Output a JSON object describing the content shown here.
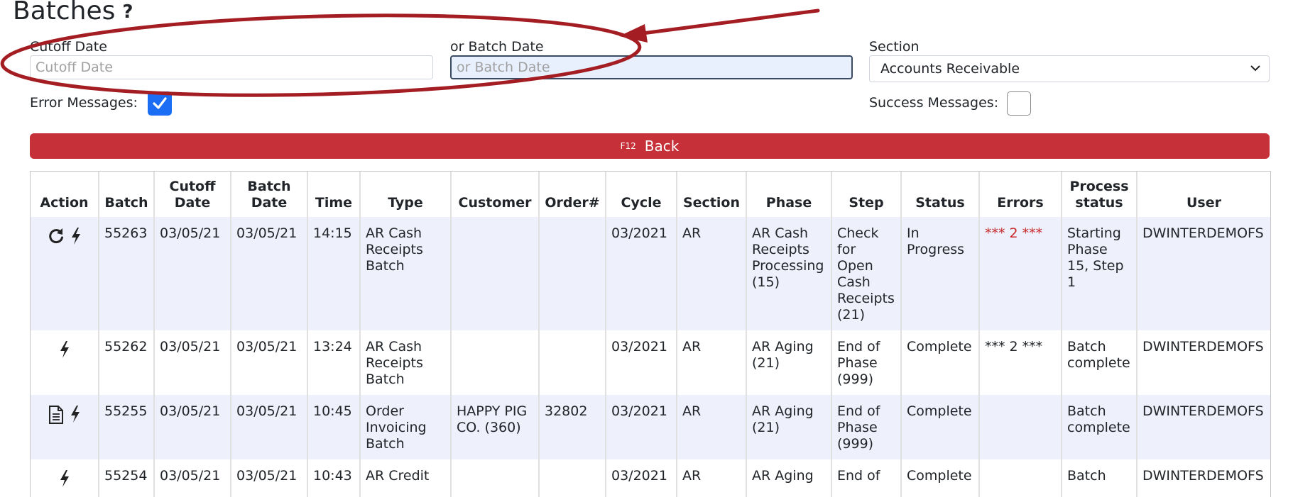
{
  "page": {
    "title": "Batches",
    "help": "?"
  },
  "filters": {
    "cutoff_label": "Cutoff Date",
    "cutoff_placeholder": "Cutoff Date",
    "cutoff_value": "",
    "batch_label": "or Batch Date",
    "batch_placeholder": "or Batch Date",
    "batch_value": "",
    "section_label": "Section",
    "section_value": "Accounts Receivable",
    "error_label": "Error Messages:",
    "error_checked": true,
    "success_label": "Success Messages:",
    "success_checked": false
  },
  "back": {
    "key": "F12",
    "label": "Back"
  },
  "colors": {
    "back_bar": "#c63038",
    "annotation": "#a31d22",
    "checkbox": "#1b6ef3",
    "row_shade": "#eef0fb",
    "error_text": "#c62828"
  },
  "table": {
    "headers": [
      "Action",
      "Batch",
      "Cutoff Date",
      "Batch Date",
      "Time",
      "Type",
      "Customer",
      "Order#",
      "Cycle",
      "Section",
      "Phase",
      "Step",
      "Status",
      "Errors",
      "Process status",
      "User"
    ],
    "rows": [
      {
        "icons": [
          "refresh-icon",
          "bolt-icon"
        ],
        "batch": "55263",
        "cutoff": "03/05/21",
        "batchdate": "03/05/21",
        "time": "14:15",
        "type": "AR Cash Receipts Batch",
        "customer": "",
        "order": "",
        "cycle": "03/2021",
        "section": "AR",
        "phase": "AR Cash Receipts Processing (15)",
        "step": "Check for Open Cash Receipts (21)",
        "status": "In Progress",
        "errors": "*** 2 ***",
        "process": "Starting Phase 15, Step 1",
        "user": "DWINTERDEMOFS"
      },
      {
        "icons": [
          "bolt-icon"
        ],
        "batch": "55262",
        "cutoff": "03/05/21",
        "batchdate": "03/05/21",
        "time": "13:24",
        "type": "AR Cash Receipts Batch",
        "customer": "",
        "order": "",
        "cycle": "03/2021",
        "section": "AR",
        "phase": "AR Aging (21)",
        "step": "End of Phase (999)",
        "status": "Complete",
        "errors": "*** 2 ***",
        "process": "Batch complete",
        "user": "DWINTERDEMOFS"
      },
      {
        "icons": [
          "document-icon",
          "bolt-icon"
        ],
        "batch": "55255",
        "cutoff": "03/05/21",
        "batchdate": "03/05/21",
        "time": "10:45",
        "type": "Order Invoicing Batch",
        "customer": "HAPPY PIG CO. (360)",
        "order": "32802",
        "cycle": "03/2021",
        "section": "AR",
        "phase": "AR Aging (21)",
        "step": "End of Phase (999)",
        "status": "Complete",
        "errors": "",
        "process": "Batch complete",
        "user": "DWINTERDEMOFS"
      },
      {
        "icons": [
          "bolt-icon"
        ],
        "batch": "55254",
        "cutoff": "03/05/21",
        "batchdate": "03/05/21",
        "time": "10:43",
        "type": "AR Credit",
        "customer": "",
        "order": "",
        "cycle": "03/2021",
        "section": "AR",
        "phase": "AR Aging",
        "step": "End of",
        "status": "Complete",
        "errors": "",
        "process": "Batch",
        "user": "DWINTERDEMOFS"
      }
    ]
  }
}
